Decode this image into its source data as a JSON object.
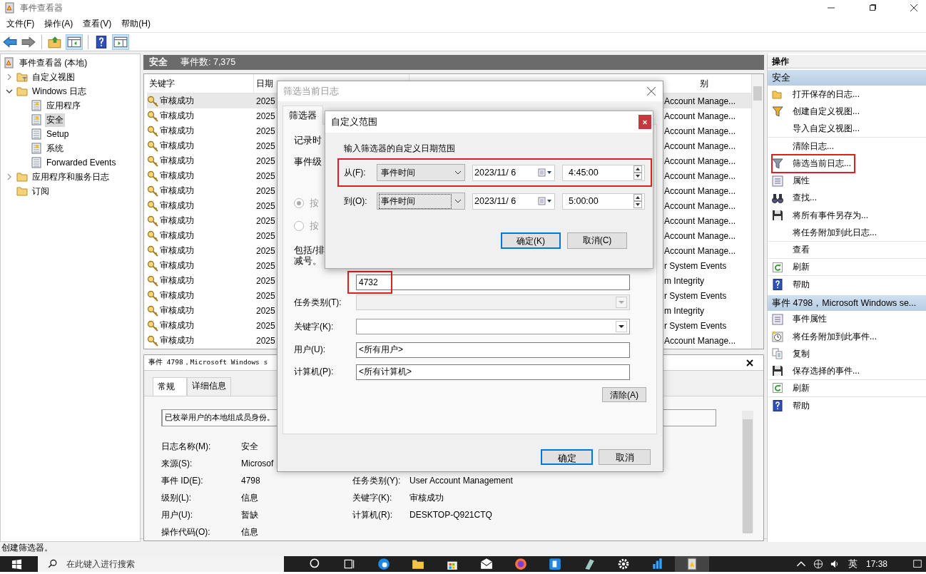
{
  "window": {
    "title": "事件查看器"
  },
  "menu": [
    "文件(F)",
    "操作(A)",
    "查看(V)",
    "帮助(H)"
  ],
  "tree": [
    {
      "label": "事件查看器 (本地)",
      "kind": "root",
      "selected": false,
      "children": [
        {
          "label": "自定义视图",
          "kind": "filter-folder",
          "expanded": false,
          "selected": false
        },
        {
          "label": "Windows 日志",
          "kind": "folder",
          "expanded": true,
          "selected": false,
          "children": [
            {
              "label": "应用程序",
              "kind": "log",
              "selected": false
            },
            {
              "label": "安全",
              "kind": "log",
              "selected": true
            },
            {
              "label": "Setup",
              "kind": "plain-log",
              "selected": false
            },
            {
              "label": "系统",
              "kind": "log",
              "selected": false
            },
            {
              "label": "Forwarded Events",
              "kind": "plain-log",
              "selected": false
            }
          ]
        },
        {
          "label": "应用程序和服务日志",
          "kind": "folder",
          "expanded": false,
          "selected": false
        },
        {
          "label": "订阅",
          "kind": "folder",
          "selected": false
        }
      ]
    }
  ],
  "log_header": {
    "name": "安全",
    "count": "事件数: 7,375"
  },
  "table": {
    "columns": [
      "关键字",
      "日期",
      "别"
    ],
    "rows": [
      {
        "keyword": "审核成功",
        "date": "2025",
        "category": "Account Manage...",
        "selected": true
      },
      {
        "keyword": "审核成功",
        "date": "2025",
        "category": "Account Manage...",
        "selected": false
      },
      {
        "keyword": "审核成功",
        "date": "2025",
        "category": "Account Manage...",
        "selected": false
      },
      {
        "keyword": "审核成功",
        "date": "2025",
        "category": "Account Manage...",
        "selected": false
      },
      {
        "keyword": "审核成功",
        "date": "2025",
        "category": "Account Manage...",
        "selected": false
      },
      {
        "keyword": "审核成功",
        "date": "2025",
        "category": "Account Manage...",
        "selected": false
      },
      {
        "keyword": "审核成功",
        "date": "2025",
        "category": "Account Manage...",
        "selected": false
      },
      {
        "keyword": "审核成功",
        "date": "2025",
        "category": "Account Manage...",
        "selected": false
      },
      {
        "keyword": "审核成功",
        "date": "2025",
        "category": "Account Manage...",
        "selected": false
      },
      {
        "keyword": "审核成功",
        "date": "2025",
        "category": "Account Manage...",
        "selected": false
      },
      {
        "keyword": "审核成功",
        "date": "2025",
        "category": "Account Manage...",
        "selected": false
      },
      {
        "keyword": "审核成功",
        "date": "2025",
        "category": "r System Events",
        "selected": false
      },
      {
        "keyword": "审核成功",
        "date": "2025",
        "category": "m Integrity",
        "selected": false
      },
      {
        "keyword": "审核成功",
        "date": "2025",
        "category": "r System Events",
        "selected": false
      },
      {
        "keyword": "审核成功",
        "date": "2025",
        "category": "m Integrity",
        "selected": false
      },
      {
        "keyword": "审核成功",
        "date": "2025",
        "category": "r System Events",
        "selected": false
      },
      {
        "keyword": "审核成功",
        "date": "2025",
        "category": "Account Manage...",
        "selected": false
      }
    ]
  },
  "details": {
    "title": "事件 4798，Microsoft Windows s",
    "tabs": [
      {
        "label": "常规",
        "selected": true
      },
      {
        "label": "详细信息",
        "selected": false
      }
    ],
    "description": "已枚举用户的本地组成员身份。",
    "rows": [
      [
        {
          "label": "日志名称(M):",
          "value": "安全"
        }
      ],
      [
        {
          "label": "来源(S):",
          "value": "Microsof"
        }
      ],
      [
        {
          "label": "事件 ID(E):",
          "value": "4798"
        },
        {
          "label": "任务类别(Y):",
          "value": "User Account Management"
        }
      ],
      [
        {
          "label": "级别(L):",
          "value": "信息"
        },
        {
          "label": "关键字(K):",
          "value": "审核成功"
        }
      ],
      [
        {
          "label": "用户(U):",
          "value": "暂缺"
        },
        {
          "label": "计算机(R):",
          "value": "DESKTOP-Q921CTQ"
        }
      ],
      [
        {
          "label": "操作代码(O):",
          "value": "信息"
        }
      ]
    ]
  },
  "filter_dialog": {
    "title": "筛选当前日志",
    "tab": "筛选器",
    "labels": [
      "记录时",
      "事件级"
    ],
    "radios": [
      {
        "label": "按",
        "selected": true
      },
      {
        "label": "按",
        "selected": false
      }
    ],
    "include_lines": [
      "包括/排",
      "减号。"
    ],
    "event_id": "4732",
    "event_id_highlighted": true,
    "fields": [
      {
        "kind": "combo",
        "label": "任务类别(T):",
        "disabled": true
      },
      {
        "kind": "combo",
        "label": "关键字(K):",
        "disabled": false
      },
      {
        "kind": "text",
        "label": "用户(U):",
        "value": "<所有用户>"
      },
      {
        "kind": "text",
        "label": "计算机(P):",
        "value": "<所有计算机>"
      }
    ],
    "clear_button": "清除(A)",
    "buttons": [
      {
        "label": "确定",
        "default": true
      },
      {
        "label": "取消",
        "default": false
      }
    ]
  },
  "range_dialog": {
    "title": "自定义范围",
    "prompt": "输入筛选器的自定义日期范围",
    "rows": [
      {
        "label": "从(F):",
        "mode": "事件时间",
        "date": "2023/11/ 6",
        "time": "4:45:00",
        "highlighted": true,
        "focused": false
      },
      {
        "label": "到(O):",
        "mode": "事件时间",
        "date": "2023/11/ 6",
        "time": "5:00:00",
        "highlighted": false,
        "focused": true
      }
    ],
    "buttons": [
      {
        "label": "确定(K)",
        "default": true
      },
      {
        "label": "取消(C)",
        "default": false
      }
    ]
  },
  "actions": {
    "title": "操作",
    "sections": [
      {
        "title": "安全",
        "items": [
          {
            "label": "打开保存的日志...",
            "kind": "folder",
            "highlighted": false,
            "separator": false
          },
          {
            "label": "创建自定义视图...",
            "kind": "filter",
            "highlighted": false,
            "separator": false
          },
          {
            "label": "导入自定义视图...",
            "kind": "none",
            "highlighted": false,
            "separator": true
          },
          {
            "label": "清除日志...",
            "kind": "none",
            "highlighted": false,
            "separator": false
          },
          {
            "label": "筛选当前日志...",
            "kind": "plain-filter",
            "highlighted": true,
            "separator": false
          },
          {
            "label": "属性",
            "kind": "properties",
            "highlighted": false,
            "separator": false
          },
          {
            "label": "查找...",
            "kind": "binoculars",
            "highlighted": false,
            "separator": false
          },
          {
            "label": "将所有事件另存为...",
            "kind": "save",
            "highlighted": false,
            "separator": false
          },
          {
            "label": "将任务附加到此日志...",
            "kind": "none",
            "highlighted": false,
            "separator": true
          },
          {
            "label": "查看",
            "kind": "none",
            "highlighted": false,
            "separator": true
          },
          {
            "label": "刷新",
            "kind": "refresh",
            "highlighted": false,
            "separator": true
          },
          {
            "label": "帮助",
            "kind": "help",
            "highlighted": false,
            "separator": false
          }
        ]
      },
      {
        "title": "事件 4798，Microsoft Windows se...",
        "items": [
          {
            "label": "事件属性",
            "kind": "properties",
            "highlighted": false,
            "separator": false
          },
          {
            "label": "将任务附加到此事件...",
            "kind": "clock",
            "highlighted": false,
            "separator": false
          },
          {
            "label": "复制",
            "kind": "copy",
            "highlighted": false,
            "separator": false
          },
          {
            "label": "保存选择的事件...",
            "kind": "save",
            "highlighted": false,
            "separator": true
          },
          {
            "label": "刷新",
            "kind": "refresh",
            "highlighted": false,
            "separator": true
          },
          {
            "label": "帮助",
            "kind": "help",
            "highlighted": false,
            "separator": false
          }
        ]
      }
    ]
  },
  "status_bar": "创建筛选器。",
  "taskbar": {
    "search_placeholder": "在此键入进行搜索",
    "ime": "英",
    "time": "17:38"
  }
}
